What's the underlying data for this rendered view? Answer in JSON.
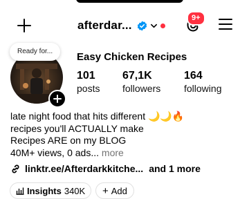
{
  "header": {
    "username": "afterdar...",
    "notification_badge": "9+",
    "icons": [
      "plus-icon",
      "verified-icon",
      "chevron-down-icon",
      "threads-icon",
      "hamburger-menu-icon"
    ],
    "colors": {
      "verified": "#0095f6",
      "badge": "#ff3040"
    }
  },
  "profile": {
    "note": "Ready for...",
    "display_name": "Easy Chicken Recipes",
    "stats": [
      {
        "value": "101",
        "label": "posts"
      },
      {
        "value": "67,1K",
        "label": "followers"
      },
      {
        "value": "164",
        "label": "following"
      }
    ]
  },
  "bio": {
    "line1": "late night food that hits different 🌙🌙🔥",
    "line2": "recipes you'll ACTUALLY make",
    "line3": "Recipes ARE on my BLOG",
    "line4": "40M+ views, 0 ads...",
    "more": "more"
  },
  "links": {
    "url": "linktr.ee/Afterdarkkitche...",
    "more": "and 1 more"
  },
  "actions": {
    "insights_label": "Insights",
    "insights_count": "340K",
    "add_label": "Add"
  }
}
